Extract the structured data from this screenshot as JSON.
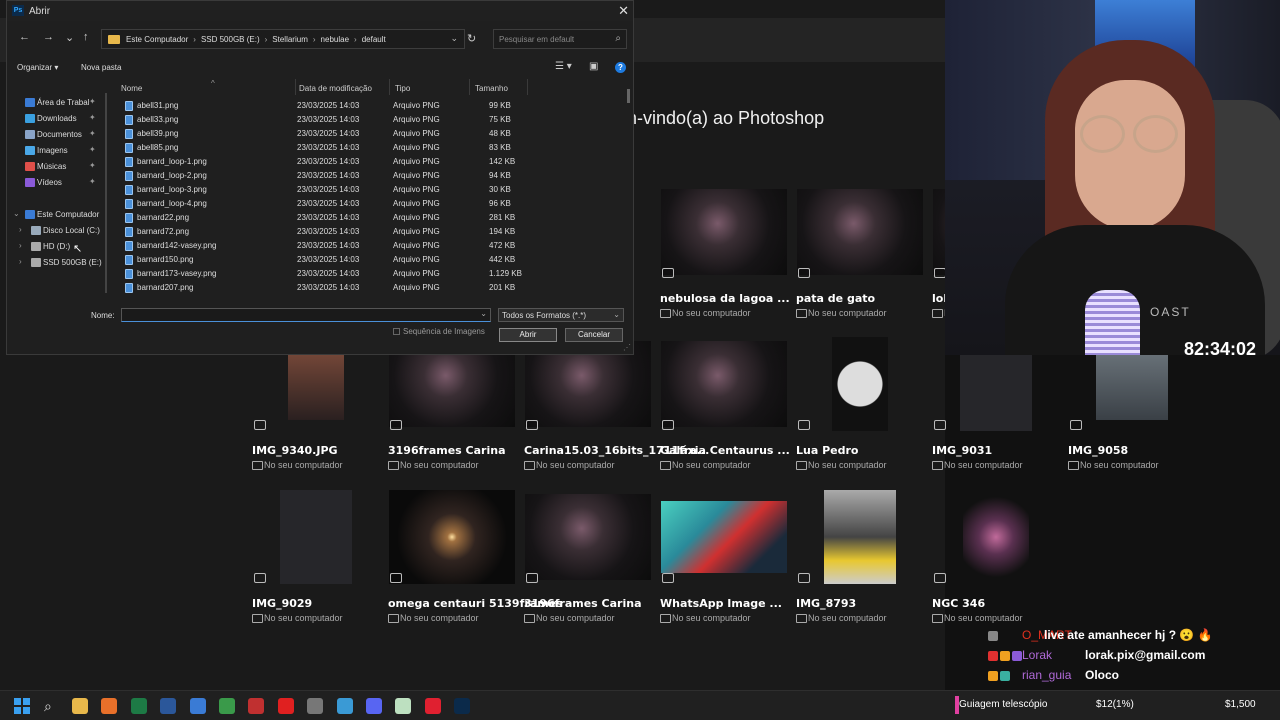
{
  "photoshop": {
    "welcome": "em-vindo(a) ao Photoshop",
    "location_label": "No seu computador",
    "row1": [
      {
        "name": "nebulosa da lagoa ...",
        "style": "star"
      },
      {
        "name": "pata de gato",
        "style": "star"
      },
      {
        "name": "lob",
        "style": "star"
      }
    ],
    "row2": [
      {
        "name": "IMG_9340.JPG",
        "style": "portrait"
      },
      {
        "name": "3196frames Carina",
        "style": "star"
      },
      {
        "name": "Carina15.03_16bits_1711fra...",
        "style": "star"
      },
      {
        "name": "Galáxia Centaurus ...",
        "style": "star"
      },
      {
        "name": "Lua Pedro",
        "style": "moon"
      },
      {
        "name": "IMG_9031",
        "style": "dark"
      },
      {
        "name": "IMG_9058",
        "style": "gray"
      }
    ],
    "row3": [
      {
        "name": "IMG_9029",
        "style": "dark"
      },
      {
        "name": "omega centauri 5139frames",
        "style": "cluster"
      },
      {
        "name": "3196frames Carina",
        "style": "star"
      },
      {
        "name": "WhatsApp Image ...",
        "style": "art"
      },
      {
        "name": "IMG_8793",
        "style": "yellow"
      },
      {
        "name": "NGC 346",
        "style": "nebula"
      }
    ]
  },
  "dialog": {
    "app_badge": "Ps",
    "title": "Abrir",
    "close": "✕",
    "nav": {
      "back": "←",
      "forward": "→",
      "recent": "⌄",
      "up": "↑"
    },
    "breadcrumbs": [
      "Este Computador",
      "SSD 500GB (E:)",
      "Stellarium",
      "nebulae",
      "default"
    ],
    "breadcrumb_sep": "›",
    "refresh": "↻",
    "search_placeholder": "Pesquisar em default",
    "toolbar": {
      "organize": "Organizar ▾",
      "new_folder": "Nova pasta"
    },
    "sidebar": [
      {
        "label": "Área de Trabal",
        "color": "#3a7bd5",
        "pinned": true
      },
      {
        "label": "Downloads",
        "color": "#3aa0e0",
        "pinned": true
      },
      {
        "label": "Documentos",
        "color": "#8aa4c8",
        "pinned": true
      },
      {
        "label": "Imagens",
        "color": "#4aa8e8",
        "pinned": true
      },
      {
        "label": "Músicas",
        "color": "#e0504a",
        "pinned": true
      },
      {
        "label": "Vídeos",
        "color": "#8a5ad8",
        "pinned": true
      }
    ],
    "tree": [
      {
        "label": "Este Computador",
        "color": "#3a7bd5",
        "expanded": true
      },
      {
        "label": "Disco Local (C:)",
        "color": "#9ab"
      },
      {
        "label": "HD (D:)",
        "color": "#aaa"
      },
      {
        "label": "SSD 500GB (E:)",
        "color": "#aaa"
      }
    ],
    "columns": {
      "name": "Nome",
      "date": "Data de modificação",
      "type": "Tipo",
      "size": "Tamanho"
    },
    "files": [
      {
        "name": "abell31.png",
        "date": "23/03/2025 14:03",
        "type": "Arquivo PNG",
        "size": "99 KB"
      },
      {
        "name": "abell33.png",
        "date": "23/03/2025 14:03",
        "type": "Arquivo PNG",
        "size": "75 KB"
      },
      {
        "name": "abell39.png",
        "date": "23/03/2025 14:03",
        "type": "Arquivo PNG",
        "size": "48 KB"
      },
      {
        "name": "abell85.png",
        "date": "23/03/2025 14:03",
        "type": "Arquivo PNG",
        "size": "83 KB"
      },
      {
        "name": "barnard_loop-1.png",
        "date": "23/03/2025 14:03",
        "type": "Arquivo PNG",
        "size": "142 KB"
      },
      {
        "name": "barnard_loop-2.png",
        "date": "23/03/2025 14:03",
        "type": "Arquivo PNG",
        "size": "94 KB"
      },
      {
        "name": "barnard_loop-3.png",
        "date": "23/03/2025 14:03",
        "type": "Arquivo PNG",
        "size": "30 KB"
      },
      {
        "name": "barnard_loop-4.png",
        "date": "23/03/2025 14:03",
        "type": "Arquivo PNG",
        "size": "96 KB"
      },
      {
        "name": "barnard22.png",
        "date": "23/03/2025 14:03",
        "type": "Arquivo PNG",
        "size": "281 KB"
      },
      {
        "name": "barnard72.png",
        "date": "23/03/2025 14:03",
        "type": "Arquivo PNG",
        "size": "194 KB"
      },
      {
        "name": "barnard142-vasey.png",
        "date": "23/03/2025 14:03",
        "type": "Arquivo PNG",
        "size": "472 KB"
      },
      {
        "name": "barnard150.png",
        "date": "23/03/2025 14:03",
        "type": "Arquivo PNG",
        "size": "442 KB"
      },
      {
        "name": "barnard173-vasey.png",
        "date": "23/03/2025 14:03",
        "type": "Arquivo PNG",
        "size": "1.129 KB"
      },
      {
        "name": "barnard207.png",
        "date": "23/03/2025 14:03",
        "type": "Arquivo PNG",
        "size": "201 KB"
      }
    ],
    "name_label": "Nome:",
    "name_value": "",
    "format": "Todos os Formatos (*.*)",
    "sequence_label": "Sequência de Imagens",
    "open_button": "Abrir",
    "cancel_button": "Cancelar"
  },
  "stream": {
    "timer": "82:34:02",
    "shirt_text": "OAST",
    "chat": [
      {
        "user": "O_MART",
        "user_color": "#e0301e",
        "message": "live ate amanhecer hj ? 😮 🔥",
        "badges": [
          "#888"
        ]
      },
      {
        "user": "Lorak",
        "user_color": "#b06ad8",
        "message": "lorak.pix@gmail.com",
        "badges": [
          "#e03030",
          "#f0a020",
          "#8a5ad8"
        ]
      },
      {
        "user": "rian_guia",
        "user_color": "#b06ad8",
        "message": "Oloco",
        "badges": [
          "#f0a020",
          "#3ab0a0"
        ]
      }
    ],
    "goal": {
      "label": "Guiagem telescópio",
      "progress": "$12(1%)",
      "target": "$1,500",
      "color": "#e040a0"
    }
  },
  "taskbar": {
    "search_icon": "⌕",
    "apps": [
      {
        "name": "file-explorer-icon",
        "color": "#e8b84b"
      },
      {
        "name": "firefox-icon",
        "color": "#e8702a"
      },
      {
        "name": "excel-icon",
        "color": "#1d7a45"
      },
      {
        "name": "word-icon",
        "color": "#2b579a"
      },
      {
        "name": "app-icon-blue",
        "color": "#3a7bd5"
      },
      {
        "name": "chrome-icon",
        "color": "#3a9a4a"
      },
      {
        "name": "app-icon-red",
        "color": "#c03030"
      },
      {
        "name": "youtube-icon",
        "color": "#e02020"
      },
      {
        "name": "app-icon-circle",
        "color": "#777"
      },
      {
        "name": "app-icon-cyan",
        "color": "#3a9ad5"
      },
      {
        "name": "discord-icon",
        "color": "#5865f2"
      },
      {
        "name": "notes-icon",
        "color": "#bde0c0"
      },
      {
        "name": "opera-icon",
        "color": "#e02030"
      },
      {
        "name": "photoshop-icon",
        "color": "#0b2a4a"
      }
    ]
  }
}
